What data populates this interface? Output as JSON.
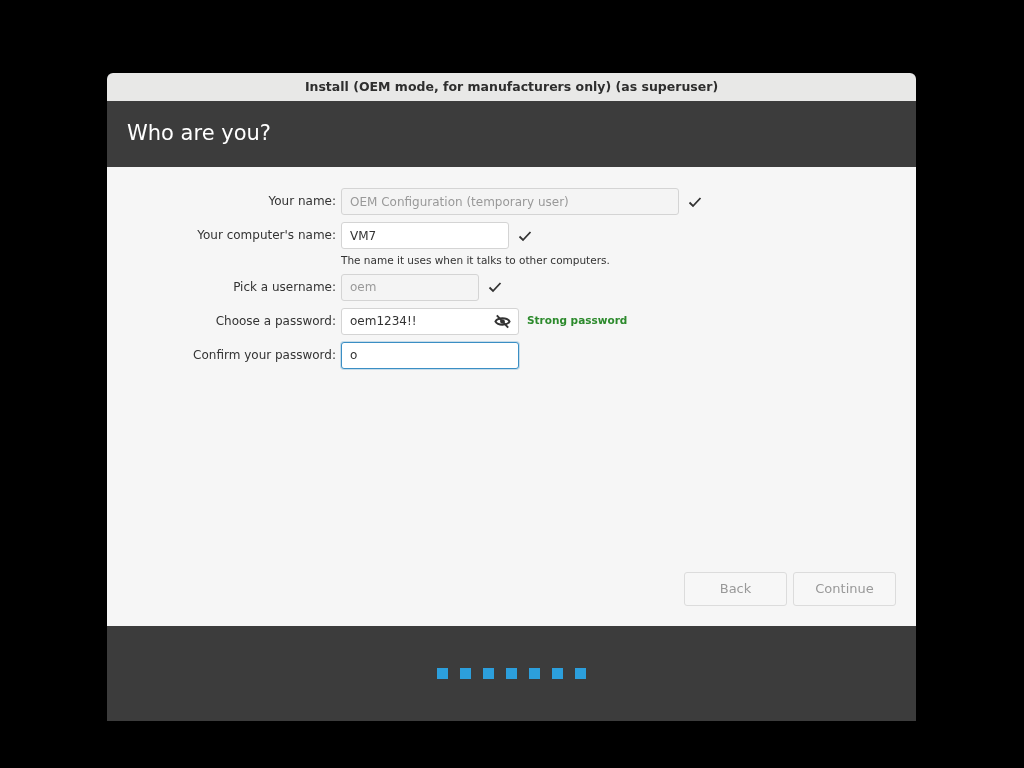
{
  "window": {
    "title": "Install (OEM mode, for manufacturers only) (as superuser)"
  },
  "header": {
    "title": "Who are you?"
  },
  "fields": [
    {
      "label": "Your name:",
      "value": "OEM Configuration (temporary user)",
      "disabled": true,
      "focused": false,
      "valid": true,
      "kind": "text"
    },
    {
      "label": "Your computer's name:",
      "value": "VM7",
      "disabled": false,
      "focused": false,
      "valid": true,
      "kind": "text",
      "hint": "The name it uses when it talks to other computers."
    },
    {
      "label": "Pick a username:",
      "value": "oem",
      "disabled": true,
      "focused": false,
      "valid": true,
      "kind": "text"
    },
    {
      "label": "Choose a password:",
      "value": "oem1234!!",
      "disabled": false,
      "focused": false,
      "valid": false,
      "kind": "password",
      "strength": "Strong password"
    },
    {
      "label": "Confirm your password:",
      "value": "o",
      "disabled": false,
      "focused": true,
      "valid": false,
      "kind": "text"
    }
  ],
  "buttons": [
    {
      "label": "Back",
      "disabled": true
    },
    {
      "label": "Continue",
      "disabled": true
    }
  ]
}
